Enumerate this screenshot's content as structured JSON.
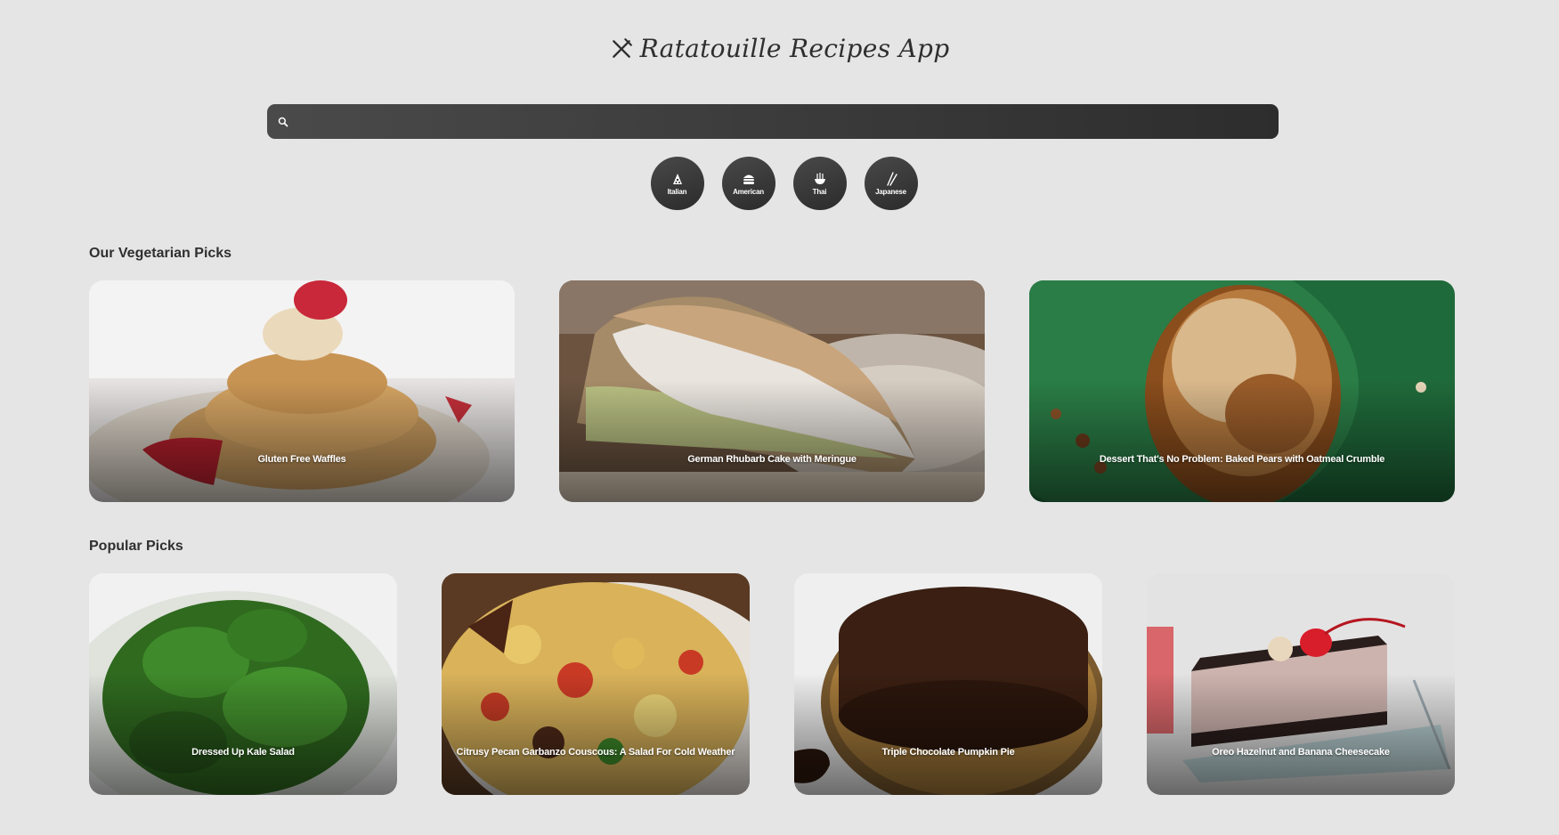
{
  "app": {
    "title": "Ratatouille Recipes App"
  },
  "search": {
    "placeholder": "",
    "value": ""
  },
  "categories": [
    {
      "label": "Italian",
      "icon": "pizza-icon"
    },
    {
      "label": "American",
      "icon": "burger-icon"
    },
    {
      "label": "Thai",
      "icon": "noodle-bowl-icon"
    },
    {
      "label": "Japanese",
      "icon": "chopsticks-icon"
    }
  ],
  "vegetarian": {
    "heading": "Our Vegetarian Picks",
    "cards": [
      {
        "title": "Gluten Free Waffles"
      },
      {
        "title": "German Rhubarb Cake with Meringue"
      },
      {
        "title": "Dessert That's No Problem: Baked Pears with Oatmeal Crumble"
      }
    ]
  },
  "popular": {
    "heading": "Popular Picks",
    "cards": [
      {
        "title": "Dressed Up Kale Salad"
      },
      {
        "title": "Citrusy Pecan Garbanzo Couscous: A Salad For Cold Weather"
      },
      {
        "title": "Triple Chocolate Pumpkin Pie"
      },
      {
        "title": "Oreo Hazelnut and Banana Cheesecake"
      }
    ]
  },
  "colors": {
    "background": "#e5e5e5",
    "dark": "#333333",
    "card_text": "#ffffff"
  }
}
